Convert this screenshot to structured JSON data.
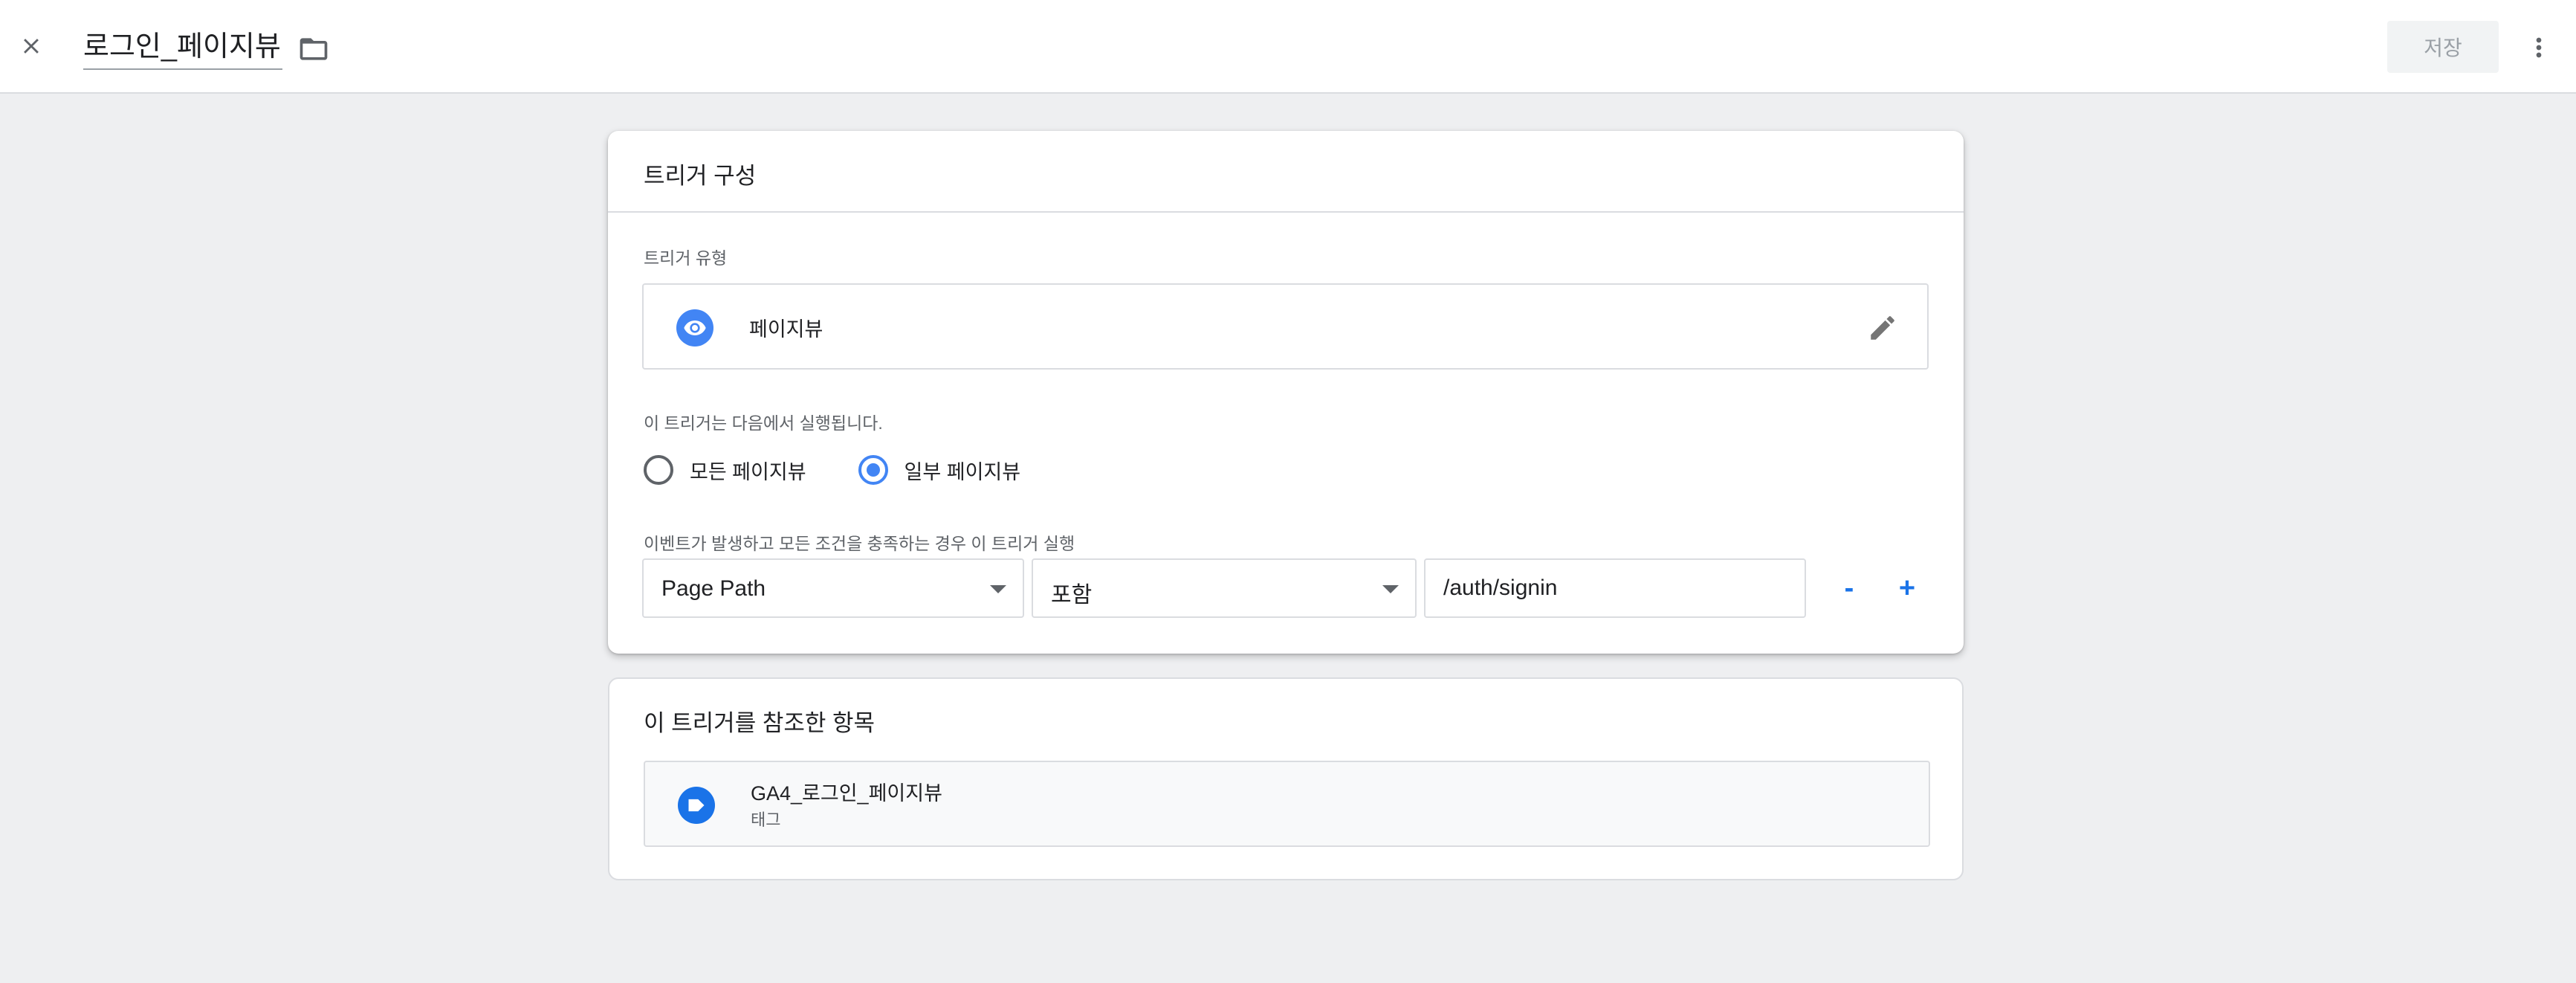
{
  "header": {
    "title": "로그인_페이지뷰",
    "save_label": "저장",
    "icons": {
      "close": "close-icon",
      "folder": "folder-icon",
      "more": "more-vert-icon"
    }
  },
  "trigger_config": {
    "title": "트리거 구성",
    "type_label": "트리거 유형",
    "type": {
      "name": "페이지뷰",
      "icon": "eye-icon",
      "icon_color": "#4285f4",
      "edit_icon": "pencil-icon"
    },
    "fires_on_label": "이 트리거는 다음에서 실행됩니다.",
    "fires_on_options": [
      {
        "label": "모든 페이지뷰",
        "checked": false
      },
      {
        "label": "일부 페이지뷰",
        "checked": true
      }
    ],
    "condition_label": "이벤트가 발생하고 모든 조건을 충족하는 경우 이 트리거 실행",
    "conditions": [
      {
        "variable": "Page Path",
        "operator": "포함",
        "value": "/auth/signin"
      }
    ],
    "remove_label": "-",
    "add_label": "+"
  },
  "references": {
    "title": "이 트리거를 참조한 항목",
    "items": [
      {
        "name": "GA4_로그인_페이지뷰",
        "type": "태그",
        "icon": "tag-icon",
        "icon_color": "#1a73e8"
      }
    ]
  },
  "colors": {
    "accent": "#1a73e8",
    "radio_accent": "#4285f4",
    "background": "#eeeff1",
    "save_disabled_bg": "#f1f3f4",
    "save_disabled_text": "#9aa0a6"
  }
}
